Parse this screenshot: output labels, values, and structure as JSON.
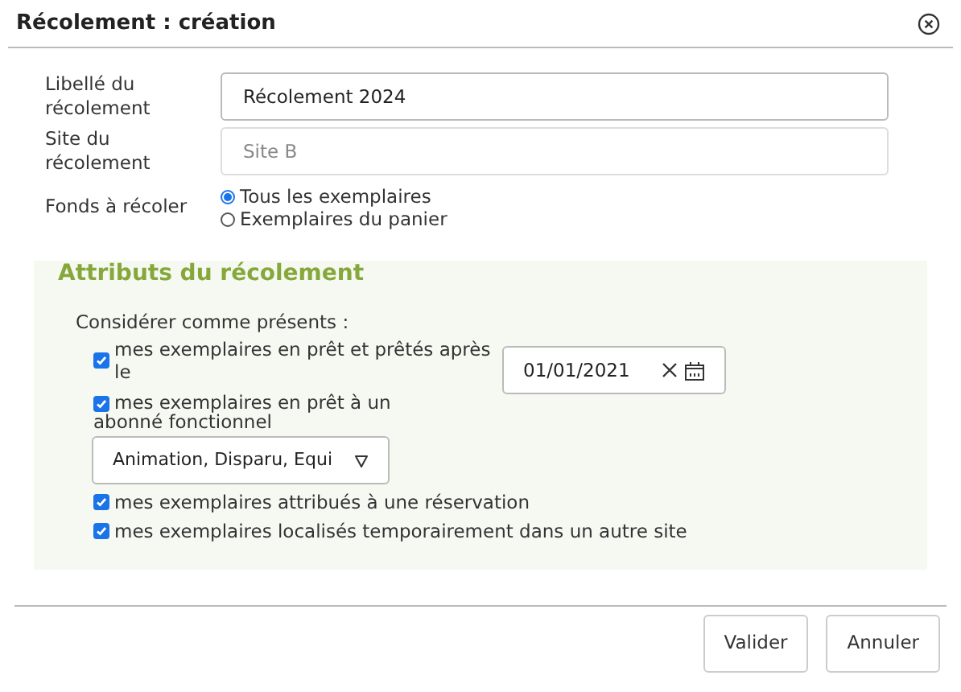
{
  "dialog": {
    "title": "Récolement : création"
  },
  "fields": [
    {
      "label": "Libellé du récolement",
      "value": "Récolement 2024",
      "disabled": false
    },
    {
      "label": "Site du récolement",
      "value": "Site B",
      "disabled": true
    }
  ],
  "fonds": {
    "label": "Fonds à récoler",
    "options": [
      {
        "label": "Tous les exemplaires",
        "selected": true
      },
      {
        "label": "Exemplaires du panier",
        "selected": false
      }
    ]
  },
  "attributes": {
    "title": "Attributs du récolement",
    "intro": "Considérer comme présents :",
    "items": [
      {
        "kind": "date",
        "label": "mes exemplaires en prêt et prêtés après le",
        "checked": true,
        "value": "01/01/2021"
      },
      {
        "kind": "select",
        "label": "mes exemplaires en prêt à un abonné fonctionnel",
        "checked": true,
        "value": "Animation, Disparu, Equi"
      },
      {
        "kind": "plain",
        "label": "mes exemplaires attribués à une réservation",
        "checked": true
      },
      {
        "kind": "plain",
        "label": "mes exemplaires localisés temporairement dans un autre site",
        "checked": true
      }
    ]
  },
  "buttons": [
    "Valider",
    "Annuler"
  ]
}
